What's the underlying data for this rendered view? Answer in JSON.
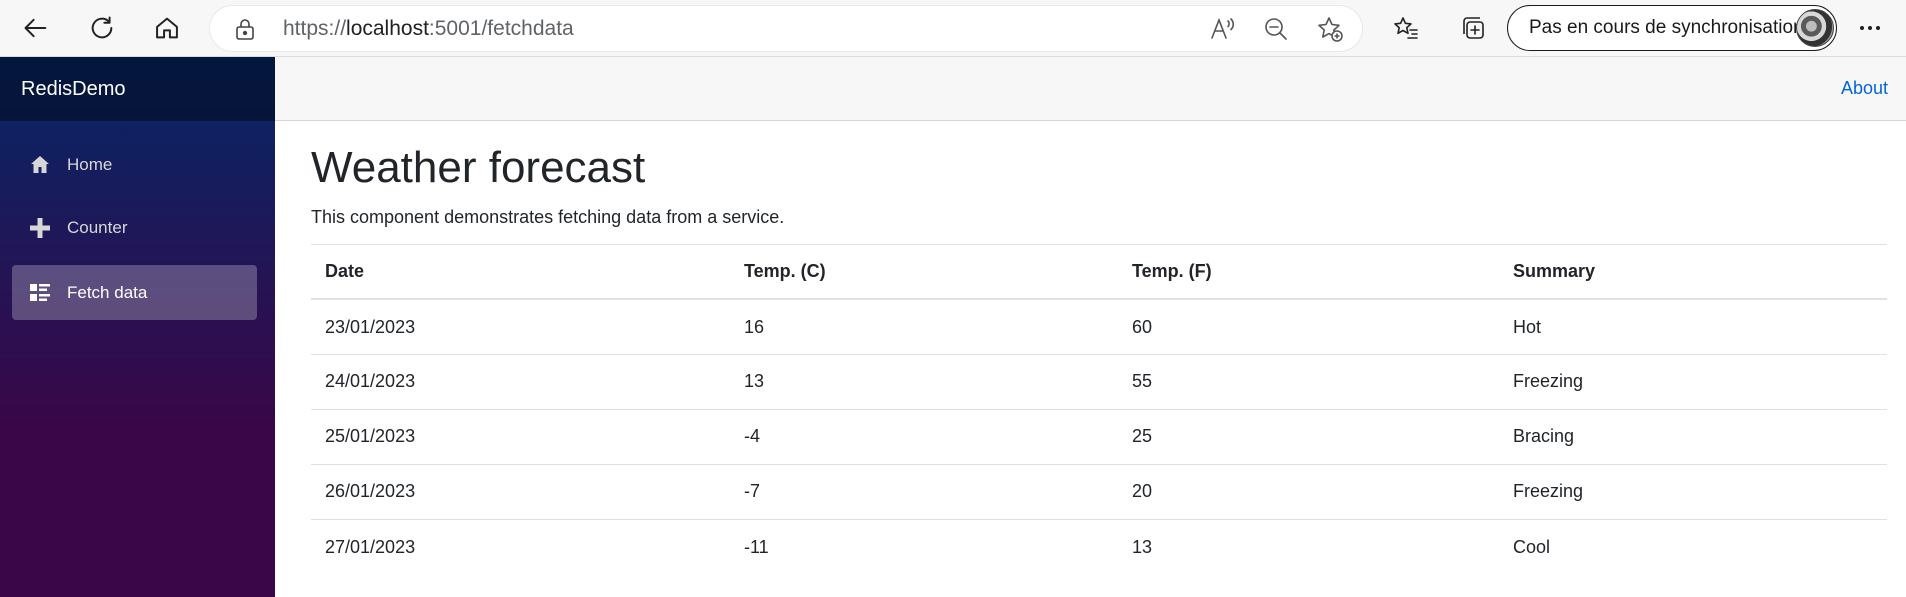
{
  "browser": {
    "url_prefix": "https://",
    "url_host": "localhost",
    "url_path": ":5001/fetchdata",
    "sync_label": "Pas en cours de synchronisation",
    "icons": {
      "back": "back-arrow-icon",
      "refresh": "refresh-icon",
      "home": "home-icon",
      "lock": "lock-icon",
      "read_aloud": "read-aloud-icon",
      "zoom_out": "zoom-out-icon",
      "add_favorite": "add-favorite-icon",
      "favorites": "favorites-icon",
      "collections": "collections-icon",
      "more": "more-icon"
    }
  },
  "sidebar": {
    "brand": "RedisDemo",
    "items": [
      {
        "label": "Home",
        "icon": "home-icon",
        "active": false
      },
      {
        "label": "Counter",
        "icon": "plus-icon",
        "active": false
      },
      {
        "label": "Fetch data",
        "icon": "list-rich-icon",
        "active": true
      }
    ]
  },
  "top_row": {
    "about_label": "About"
  },
  "main": {
    "title": "Weather forecast",
    "description": "This component demonstrates fetching data from a service.",
    "table": {
      "headers": [
        "Date",
        "Temp. (C)",
        "Temp. (F)",
        "Summary"
      ],
      "rows": [
        [
          "23/01/2023",
          "16",
          "60",
          "Hot"
        ],
        [
          "24/01/2023",
          "13",
          "55",
          "Freezing"
        ],
        [
          "25/01/2023",
          "-4",
          "25",
          "Bracing"
        ],
        [
          "26/01/2023",
          "-7",
          "20",
          "Freezing"
        ],
        [
          "27/01/2023",
          "-11",
          "13",
          "Cool"
        ]
      ]
    }
  },
  "colors": {
    "sidebar_top": "#052767",
    "sidebar_bottom": "#3a0647",
    "link": "#0366d6",
    "text": "#212529"
  }
}
